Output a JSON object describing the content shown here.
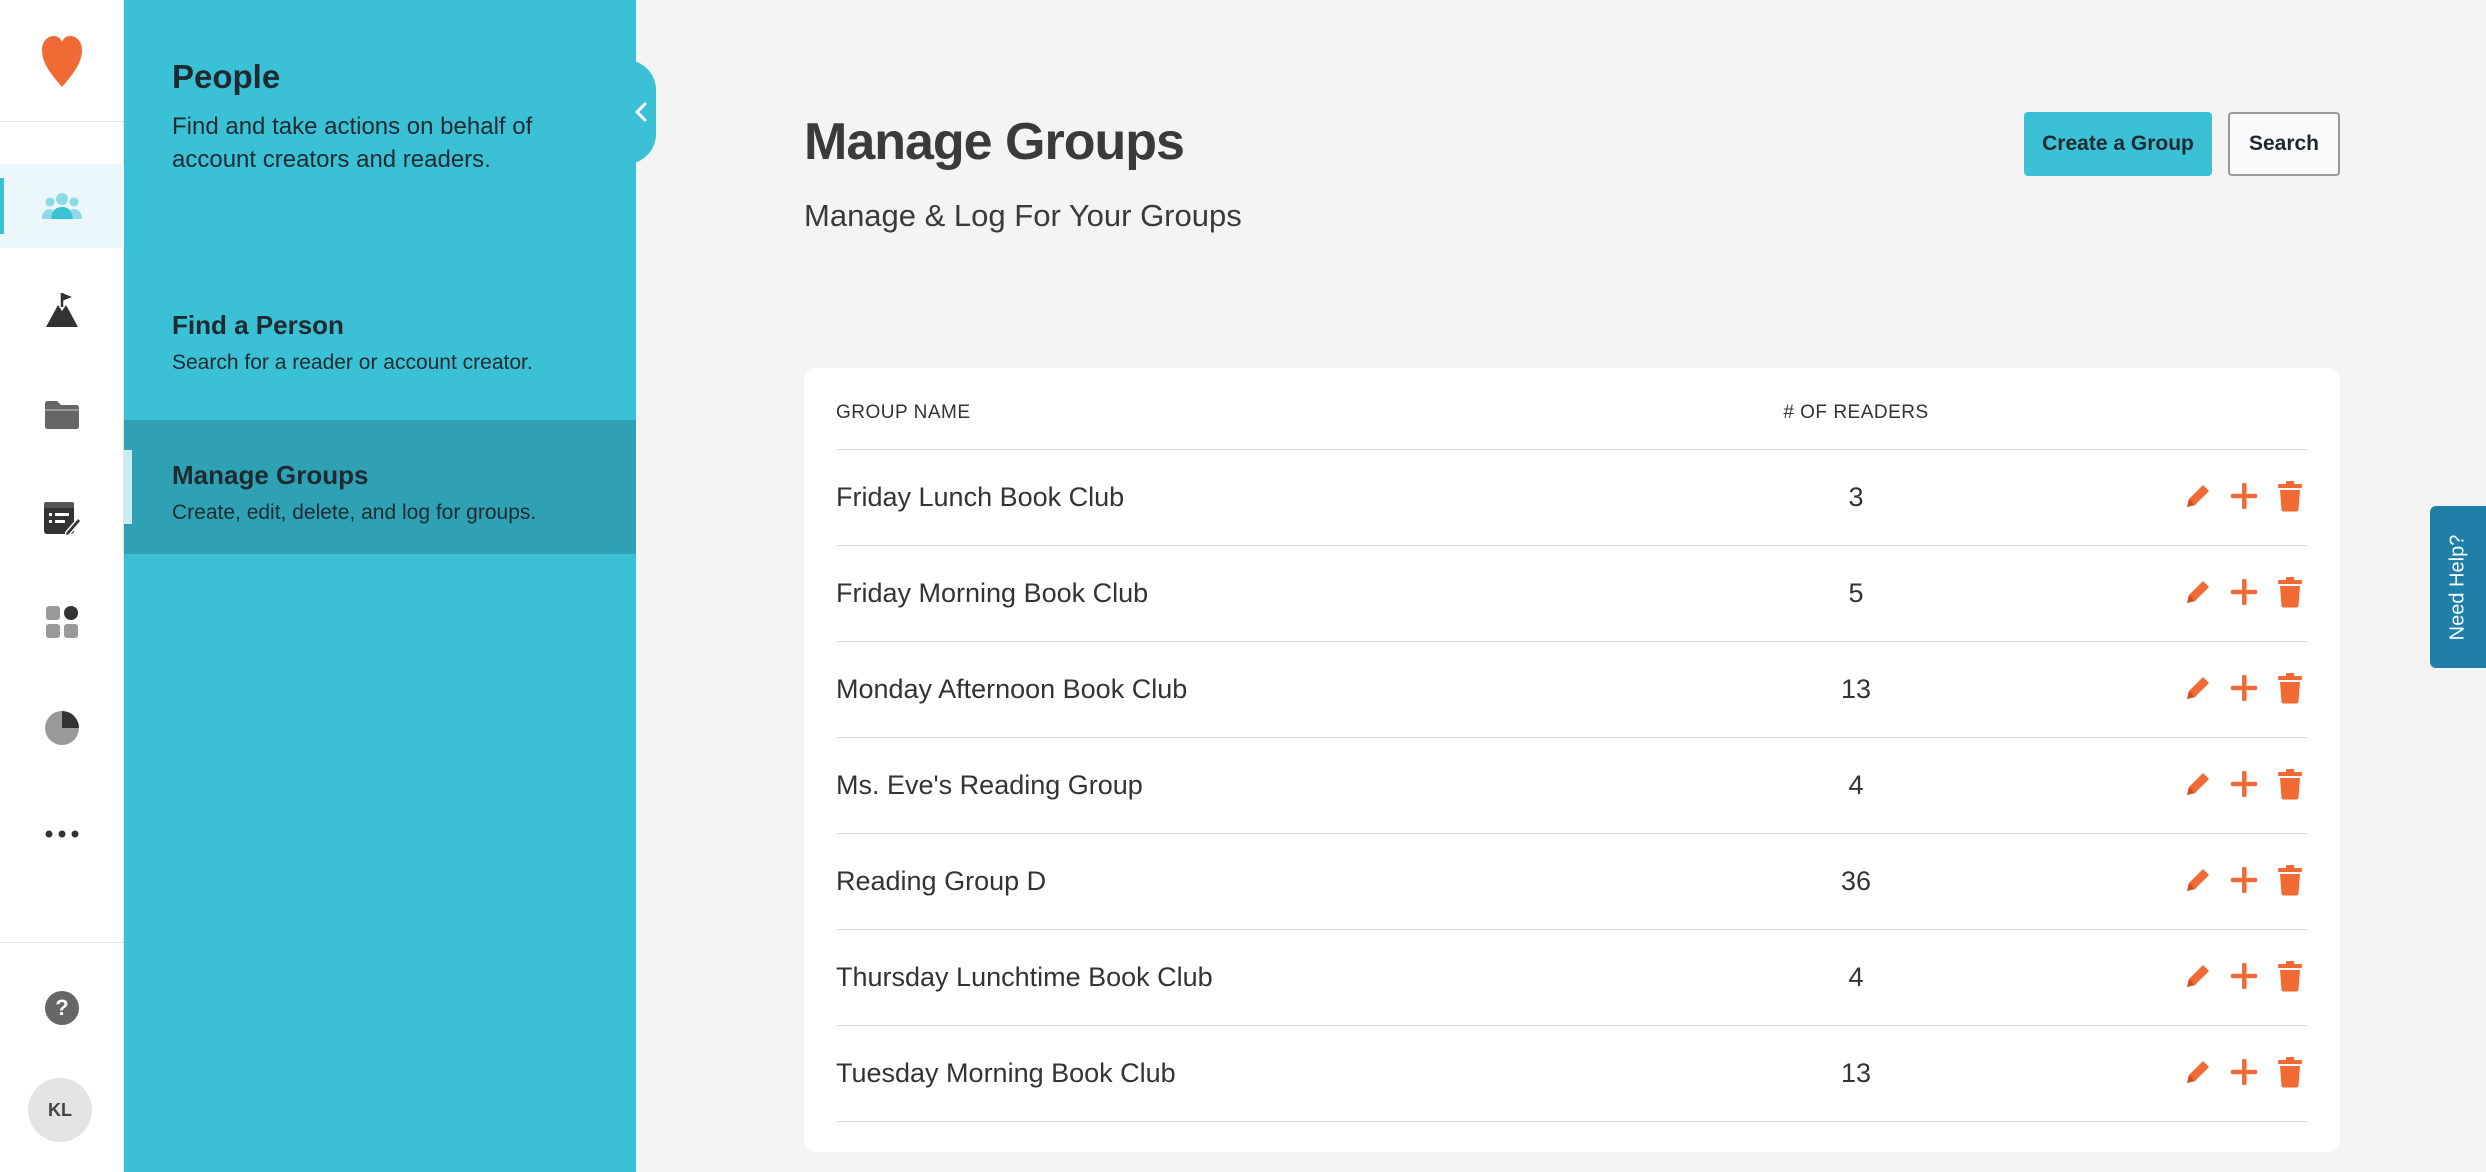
{
  "rail": {
    "items": [
      {
        "icon": "people-icon",
        "active": true
      },
      {
        "icon": "goal-flag-icon",
        "active": false
      },
      {
        "icon": "folder-icon",
        "active": false
      },
      {
        "icon": "reading-log-icon",
        "active": false
      },
      {
        "icon": "dashboard-grid-icon",
        "active": false
      },
      {
        "icon": "pie-chart-icon",
        "active": false
      },
      {
        "icon": "more-icon",
        "active": false
      }
    ],
    "help_label": "?",
    "avatar_initials": "KL"
  },
  "sidebar": {
    "title": "People",
    "description": "Find and take actions on behalf of account creators and readers.",
    "items": [
      {
        "title": "Find a Person",
        "description": "Search for a reader or account creator.",
        "active": false
      },
      {
        "title": "Manage Groups",
        "description": "Create, edit, delete, and log for groups.",
        "active": true
      }
    ]
  },
  "header": {
    "title": "Manage Groups",
    "subtitle": "Manage & Log For Your Groups",
    "create_label": "Create a Group",
    "search_label": "Search"
  },
  "table": {
    "columns": {
      "name": "GROUP NAME",
      "readers": "# OF READERS"
    },
    "rows": [
      {
        "name": "Friday Lunch Book Club",
        "readers": "3"
      },
      {
        "name": "Friday Morning Book Club",
        "readers": "5"
      },
      {
        "name": "Monday Afternoon Book Club",
        "readers": "13"
      },
      {
        "name": "Ms. Eve's Reading Group",
        "readers": "4"
      },
      {
        "name": "Reading Group D",
        "readers": "36"
      },
      {
        "name": "Thursday Lunchtime Book Club",
        "readers": "4"
      },
      {
        "name": "Tuesday Morning Book Club",
        "readers": "13"
      }
    ]
  },
  "help_tab": {
    "label": "Need Help?"
  },
  "colors": {
    "accent": "#3ac1d6",
    "accent_dark": "#2ea2b4",
    "action_orange": "#f06a35",
    "help_blue": "#1f7fa8"
  }
}
